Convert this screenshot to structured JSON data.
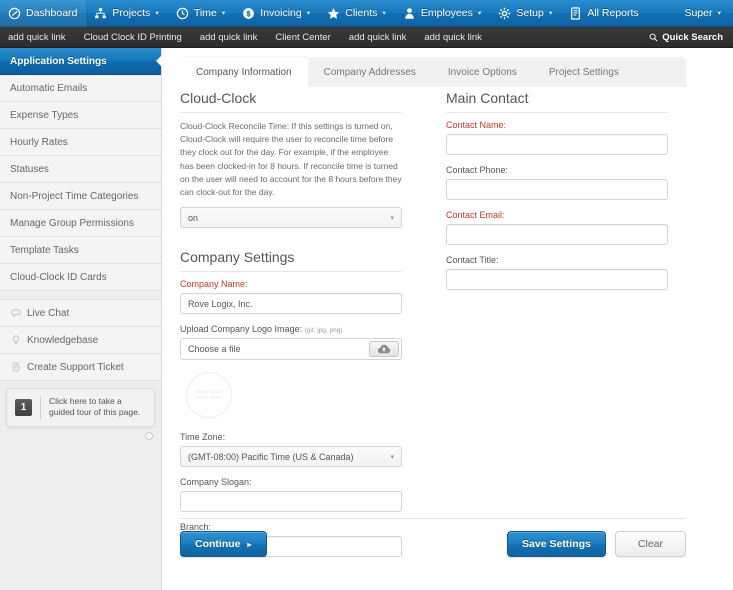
{
  "topnav": {
    "items": [
      {
        "label": "Dashboard",
        "icon": "dashboard-icon",
        "caret": false
      },
      {
        "label": "Projects",
        "icon": "projects-icon",
        "caret": true
      },
      {
        "label": "Time",
        "icon": "clock-icon",
        "caret": true
      },
      {
        "label": "Invoicing",
        "icon": "dollar-icon",
        "caret": true
      },
      {
        "label": "Clients",
        "icon": "star-icon",
        "caret": true
      },
      {
        "label": "Employees",
        "icon": "person-icon",
        "caret": true
      },
      {
        "label": "Setup",
        "icon": "gear-icon",
        "caret": true
      },
      {
        "label": "All Reports",
        "icon": "reports-icon",
        "caret": false
      }
    ],
    "user_label": "Super",
    "accent_color": "#1578bc"
  },
  "quickbar": {
    "links": [
      "add quick link",
      "Cloud Clock ID Printing",
      "add quick link",
      "Client Center",
      "add quick link",
      "add quick link"
    ],
    "search_label": "Quick Search",
    "search_icon": "magnifier-icon",
    "background_color": "#2f2f2f"
  },
  "sidebar": {
    "items": [
      {
        "label": "Application Settings",
        "active": true,
        "icon": null
      },
      {
        "label": "Automatic Emails",
        "active": false,
        "icon": null
      },
      {
        "label": "Expense Types",
        "active": false,
        "icon": null
      },
      {
        "label": "Hourly Rates",
        "active": false,
        "icon": null
      },
      {
        "label": "Statuses",
        "active": false,
        "icon": null
      },
      {
        "label": "Non-Project Time Categories",
        "active": false,
        "icon": null
      },
      {
        "label": "Manage Group Permissions",
        "active": false,
        "icon": null
      },
      {
        "label": "Template Tasks",
        "active": false,
        "icon": null
      },
      {
        "label": "Cloud-Clock ID Cards",
        "active": false,
        "icon": null
      }
    ],
    "support_items": [
      {
        "label": "Live Chat",
        "icon": "chat-bubble-icon"
      },
      {
        "label": "Knowledgebase",
        "icon": "lightbulb-icon"
      },
      {
        "label": "Create Support Ticket",
        "icon": "ticket-icon"
      }
    ],
    "tour": {
      "number": "1",
      "text": "Click here to take a guided tour of this page."
    }
  },
  "tabs": [
    {
      "label": "Company Information",
      "active": true
    },
    {
      "label": "Company Addresses",
      "active": false
    },
    {
      "label": "Invoice Options",
      "active": false
    },
    {
      "label": "Project Settings",
      "active": false
    }
  ],
  "left_column": {
    "cloud_clock": {
      "heading": "Cloud-Clock",
      "paragraph": "Cloud-Clock Reconcile Time: If this settings is turned on, Cloud-Clock will require the user to reconcile time before they clock out for the day.  For example, if the employee has been clocked-in for 8 hours.  If reconcile time is turned on the user will need to account for the 8 hours before they can clock-out for the day.",
      "select_value": "on"
    },
    "company_settings": {
      "heading": "Company Settings",
      "company_name_label": "Company Name:",
      "company_name_value": "Rove Logix, Inc.",
      "upload_label": "Upload Company Logo Image:",
      "upload_hint": "(gif, jpg, png)",
      "file_placeholder": "Choose a file",
      "file_button_icon": "cloud-upload-icon",
      "logo_placeholder_line1": "YOUR LOGO",
      "logo_placeholder_line2": "GOES HERE",
      "timezone_label": "Time Zone:",
      "timezone_value": "(GMT-08:00) Pacific Time (US & Canada)",
      "slogan_label": "Company Slogan:",
      "slogan_value": "",
      "branch_label": "Branch:",
      "branch_value": ""
    }
  },
  "right_column": {
    "heading": "Main Contact",
    "fields": [
      {
        "label": "Contact Name:",
        "value": "",
        "required": true
      },
      {
        "label": "Contact Phone:",
        "value": "",
        "required": false
      },
      {
        "label": "Contact Email:",
        "value": "",
        "required": true
      },
      {
        "label": "Contact Title:",
        "value": "",
        "required": false
      }
    ]
  },
  "actions": {
    "continue_label": "Continue",
    "continue_caret": "▸",
    "save_label": "Save Settings",
    "clear_label": "Clear"
  }
}
